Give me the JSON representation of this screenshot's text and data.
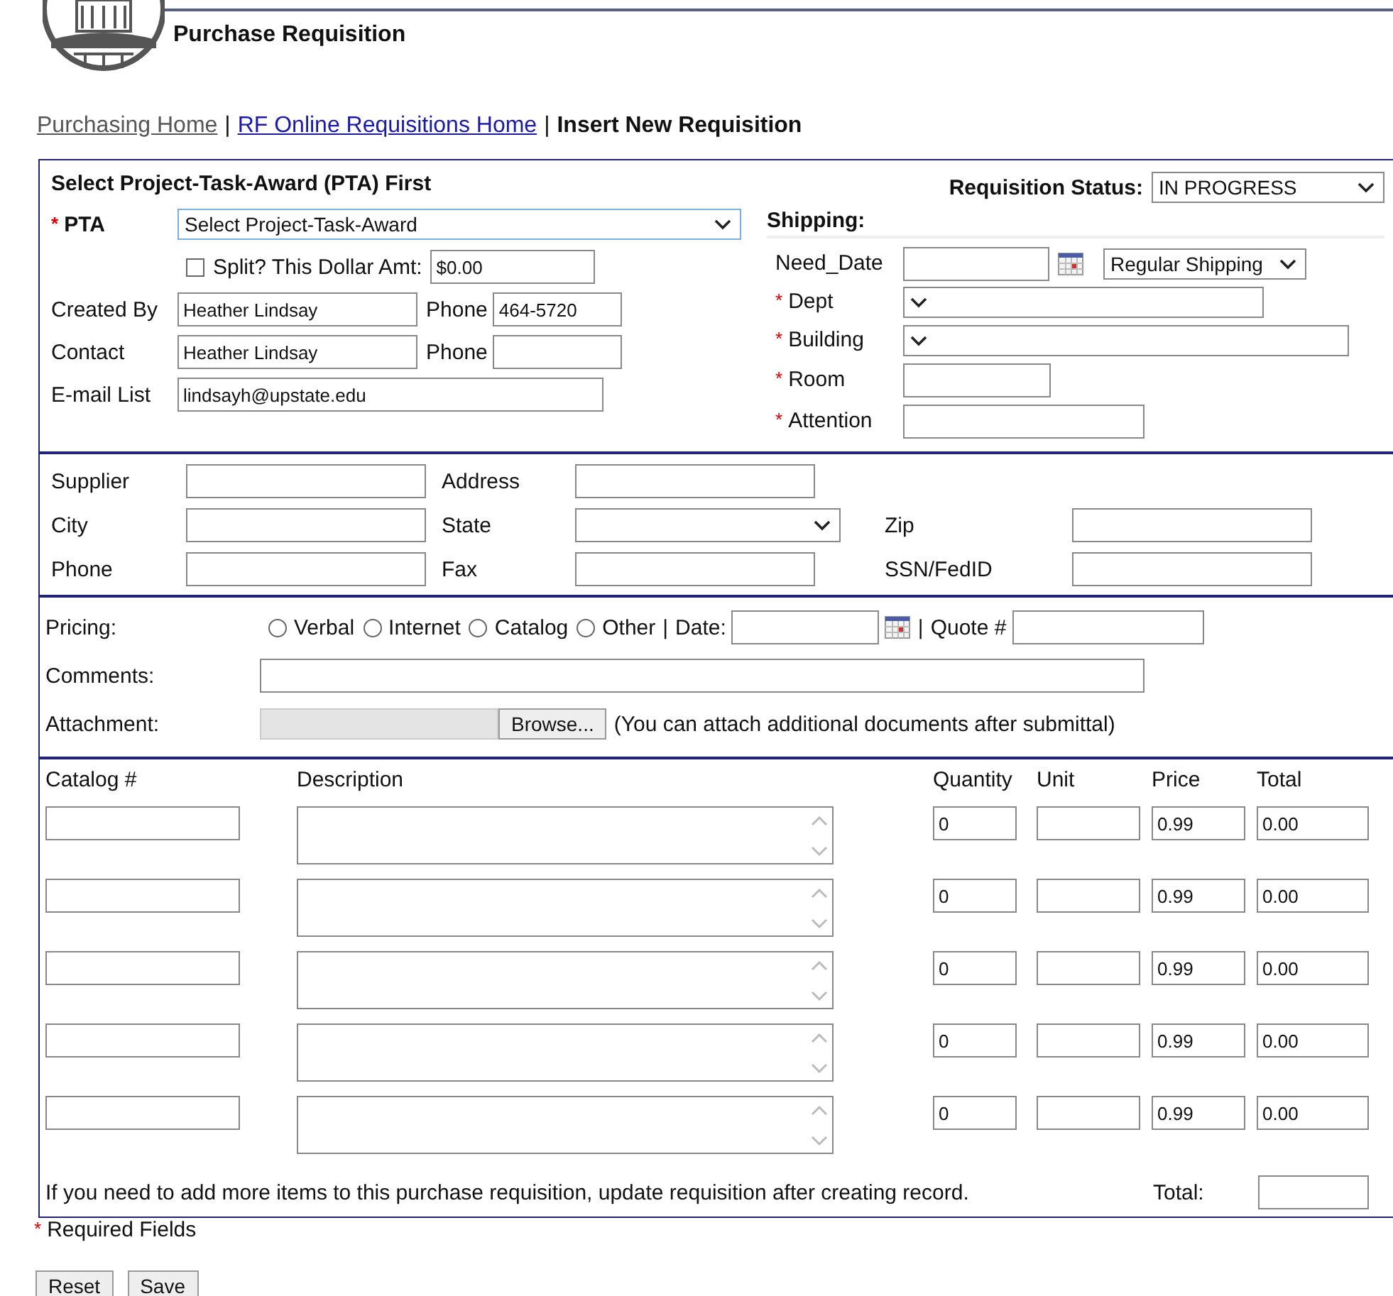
{
  "header": {
    "title": "Purchase Requisition"
  },
  "breadcrumb": {
    "separator": "|",
    "items": [
      {
        "label": "Purchasing Home",
        "kind": "visited"
      },
      {
        "label": "RF Online Requisitions Home",
        "kind": "link"
      },
      {
        "label": "Insert New Requisition",
        "kind": "current"
      }
    ]
  },
  "required_mark": "*",
  "pta_section": {
    "heading": "Select Project-Task-Award (PTA) First",
    "pta": {
      "label": "PTA",
      "required": true,
      "value": "Select Project-Task-Award"
    },
    "split": {
      "label": "Split? This Dollar Amt:",
      "checked": false,
      "value": "$0.00"
    },
    "people": [
      {
        "label": "Created By",
        "value": "Heather Lindsay",
        "phone_label": "Phone",
        "phone": "464-5720"
      },
      {
        "label": "Contact",
        "value": "Heather Lindsay",
        "phone_label": "Phone"
      }
    ],
    "email": {
      "label": "E-mail List",
      "value": "lindsayh@upstate.edu"
    }
  },
  "status": {
    "label": "Requisition Status:",
    "value": "IN PROGRESS"
  },
  "shipping": {
    "heading": "Shipping:",
    "need_date": {
      "label": "Need_Date",
      "method": "Regular Shipping"
    },
    "fields": [
      {
        "label": "Dept",
        "required": true,
        "kind": "select"
      },
      {
        "label": "Building",
        "required": true,
        "kind": "select"
      },
      {
        "label": "Room",
        "required": true,
        "kind": "text"
      },
      {
        "label": "Attention",
        "required": true,
        "kind": "text"
      }
    ]
  },
  "supplier": {
    "rows": [
      [
        {
          "label": "Supplier",
          "kind": "text"
        },
        {
          "label": "Address",
          "kind": "text"
        }
      ],
      [
        {
          "label": "City",
          "kind": "text"
        },
        {
          "label": "State",
          "kind": "select"
        },
        {
          "label": "Zip",
          "kind": "text"
        }
      ],
      [
        {
          "label": "Phone",
          "kind": "text"
        },
        {
          "label": "Fax",
          "kind": "text"
        },
        {
          "label": "SSN/FedID",
          "kind": "text"
        }
      ]
    ]
  },
  "pricing": {
    "label": "Pricing:",
    "options": [
      {
        "label": "Verbal",
        "selected": false
      },
      {
        "label": "Internet",
        "selected": false
      },
      {
        "label": "Catalog",
        "selected": false
      },
      {
        "label": "Other",
        "selected": false
      }
    ],
    "separator": "|",
    "date_label": "Date:",
    "quote_label": "Quote #"
  },
  "comments": {
    "label": "Comments:"
  },
  "attachment": {
    "label": "Attachment:",
    "button": "Browse...",
    "note": "(You can attach additional documents after submittal)"
  },
  "items": {
    "columns": [
      "Catalog #",
      "Description",
      "Quantity",
      "Unit",
      "Price",
      "Total"
    ],
    "rows": [
      {
        "quantity": "0",
        "price": "0.99",
        "total": "0.00"
      },
      {
        "quantity": "0",
        "price": "0.99",
        "total": "0.00"
      },
      {
        "quantity": "0",
        "price": "0.99",
        "total": "0.00"
      },
      {
        "quantity": "0",
        "price": "0.99",
        "total": "0.00"
      },
      {
        "quantity": "0",
        "price": "0.99",
        "total": "0.00"
      }
    ],
    "note": "If you need to add more items to this purchase requisition, update requisition after creating record.",
    "total_label": "Total:"
  },
  "required_note": "Required Fields",
  "buttons": [
    "Reset",
    "Save"
  ]
}
